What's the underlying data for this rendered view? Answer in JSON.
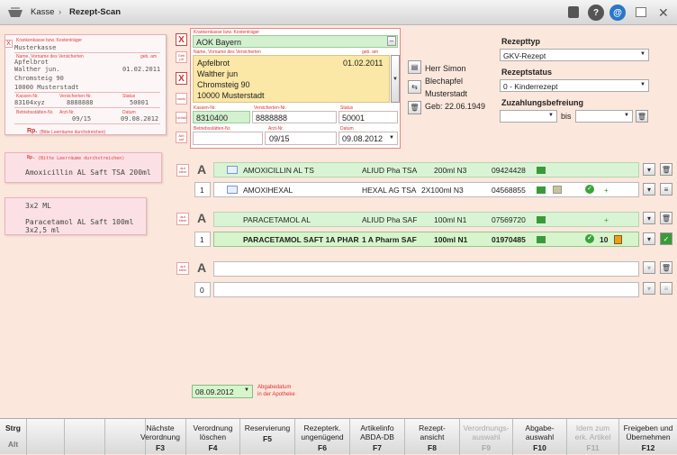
{
  "titlebar": {
    "crumb_home": "Kasse",
    "separator": "›",
    "crumb_current": "Rezept-Scan"
  },
  "scan_slip": {
    "header_label": "Krankenkasse bzw. Kostenträger",
    "kasse": "Musterkasse",
    "name_label": "Name, Vorname des Versicherten",
    "born_label": "geb. am",
    "name1": "Apfelbrot",
    "name2": "Walther jun.",
    "born": "01.02.2011",
    "street": "Chromsteig 90",
    "city": "10000 Musterstadt",
    "kassennr_label": "Kassen-Nr.",
    "versnr_label": "Versicherten-Nr.",
    "status_label": "Status",
    "kassennr": "83104xyz",
    "versnr": "8888888",
    "status": "50001",
    "bsnr_label": "Betriebsstätten-Nr.",
    "arzt_label": "Arzt-Nr.",
    "datum_label": "Datum",
    "arzt": "09/15",
    "datum": "09.08.2012",
    "rp": "Rp.",
    "rp_note": "(Bitte Leerräume durchstreichen)"
  },
  "rx_slips": [
    {
      "lines": [
        "Amoxicillin AL Saft TSA 200ml"
      ]
    },
    {
      "lines": [
        "3x2 ML",
        "Paracetamol AL Saft 100ml",
        "3x2,5 ml"
      ]
    }
  ],
  "form": {
    "kasse_label": "Krankenkasse bzw. Kostenträger",
    "kasse": "AOK Bayern",
    "name_label": "Name, Vorname des Versicherten",
    "born_label": "geb. am",
    "name1": "Apfelbrot",
    "name2": "Walther jun",
    "born": "01.02.2011",
    "street": "Chromsteig 90",
    "city": "10000 Musterstadt",
    "kassennr_label": "Kassen-Nr.",
    "versnr_label": "Versicherten-Nr.",
    "status_label": "Status",
    "kassennr": "8310400",
    "versnr": "8888888",
    "status": "50001",
    "bsnr_label": "Betriebsstätten-Nr.",
    "arzt_label": "Arzt-Nr.",
    "datum_label": "Datum",
    "arzt": "09/15",
    "datum": "09.08.2012"
  },
  "doctor": {
    "name": "Herr Simon",
    "street": "Blechapfel",
    "city": "Musterstadt",
    "born": "Geb: 22.06.1949"
  },
  "rezept": {
    "typ_label": "Rezepttyp",
    "typ_value": "GKV-Rezept",
    "status_label": "Rezeptstatus",
    "status_value": "0 - Kinderrezept",
    "zuzahlung_label": "Zuzahlungsbefreiung",
    "bis": "bis"
  },
  "articles": [
    {
      "qty": "A",
      "name": "AMOXICILLIN AL TS",
      "maker": "ALIUD Pha TSA",
      "size": "200ml N3",
      "pzn": "09424428",
      "kind": "request"
    },
    {
      "qty": "1",
      "name": "AMOXIHEXAL",
      "maker": "HEXAL AG TSA",
      "size": "2X100ml N3",
      "pzn": "04568855",
      "extra": "+",
      "kind": "match"
    },
    {
      "qty": "A",
      "name": "PARACETAMOL AL",
      "maker": "ALIUD Pha SAF",
      "size": "100ml N1",
      "pzn": "07569720",
      "extra": "+",
      "kind": "request"
    },
    {
      "qty": "1",
      "name": "PARACETAMOL SAFT 1A PHAR",
      "maker": "1 A Pharm SAF",
      "size": "100ml N1",
      "pzn": "01970485",
      "extra": "10",
      "kind": "match-bold"
    },
    {
      "qty": "A",
      "name": "",
      "kind": "empty"
    },
    {
      "qty": "0",
      "name": "",
      "kind": "empty"
    }
  ],
  "abgabe": {
    "date": "08.09.2012",
    "label_line1": "Abgabedatum",
    "label_line2": "in der Apotheke"
  },
  "fkeys": {
    "mods": [
      "Strg",
      "Alt"
    ],
    "keys": [
      {
        "l1": "Nächste",
        "l2": "Verordnung",
        "k": "F3",
        "enabled": true
      },
      {
        "l1": "Verordnung",
        "l2": "löschen",
        "k": "F4",
        "enabled": true
      },
      {
        "l1": "Reservierung",
        "l2": "",
        "k": "F5",
        "enabled": true
      },
      {
        "l1": "Rezepterk.",
        "l2": "ungenügend",
        "k": "F6",
        "enabled": true
      },
      {
        "l1": "Artikelinfo",
        "l2": "ABDA-DB",
        "k": "F7",
        "enabled": true
      },
      {
        "l1": "Rezept-",
        "l2": "ansicht",
        "k": "F8",
        "enabled": true
      },
      {
        "l1": "Verordnungs-",
        "l2": "auswahl",
        "k": "F9",
        "enabled": false
      },
      {
        "l1": "Abgabe-",
        "l2": "auswahl",
        "k": "F10",
        "enabled": true
      },
      {
        "l1": "Idem zum",
        "l2": "erk. Artikel",
        "k": "F11",
        "enabled": false
      },
      {
        "l1": "Freigeben und",
        "l2": "Übernehmen",
        "k": "F12",
        "enabled": true
      }
    ]
  }
}
